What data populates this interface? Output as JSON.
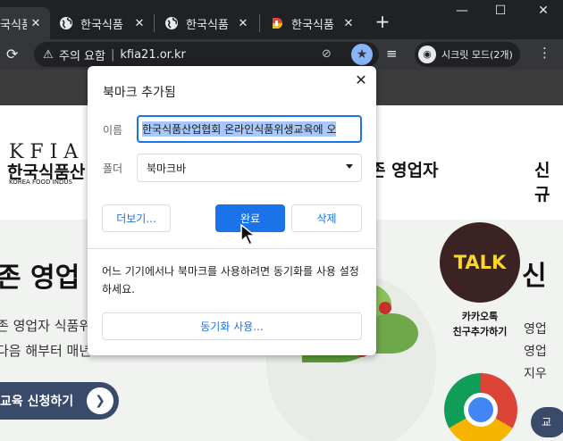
{
  "tabs": [
    {
      "title": "국식품",
      "favicon": "globe-icon"
    },
    {
      "title": "한국식품",
      "favicon": "globe-icon"
    },
    {
      "title": "한국식품",
      "favicon": "globe-icon"
    },
    {
      "title": "한국식품",
      "favicon": "d-logo-icon"
    }
  ],
  "window": {
    "new_tab": "+",
    "minimize": "—",
    "maximize": "☐",
    "close": "✕"
  },
  "toolbar": {
    "security_label": "주의 요함",
    "url": "kfia21.or.kr",
    "incognito_label": "시크릿 모드(2개)"
  },
  "page": {
    "logo_letters": "KFIA",
    "logo_name": "한국식품산",
    "logo_english": "KOREA FOOD INDUS",
    "nav_existing": "존 영업자",
    "nav_new": "신규",
    "hero_title": "존 영업",
    "hero_line1": "존 영업자 식품위",
    "hero_line2": "다음 해부터 매년",
    "enroll_button": "교육 신청하기",
    "talk_badge": "TALK",
    "kakao_line1": "카카오톡",
    "kakao_line2": "친구추가하기",
    "side_big": "신",
    "side_lines": [
      "영업",
      "영업",
      "지우"
    ],
    "side_button": "교"
  },
  "bookmark_popup": {
    "title": "북마크 추가됨",
    "name_label": "이름",
    "name_value": "한국식품산업협회 온라인식품위생교육에 오",
    "folder_label": "폴더",
    "folder_value": "북마크바",
    "more_button": "더보기...",
    "done_button": "완료",
    "delete_button": "삭제",
    "sync_text": "어느 기기에서나 북마크를 사용하려면 동기화를 사용 설정하세요.",
    "sync_button": "동기화 사용..."
  },
  "colors": {
    "accent": "#1a73e8",
    "star_active": "#8ab4f8",
    "tab_bg": "#202124",
    "toolbar_bg": "#35363a"
  }
}
